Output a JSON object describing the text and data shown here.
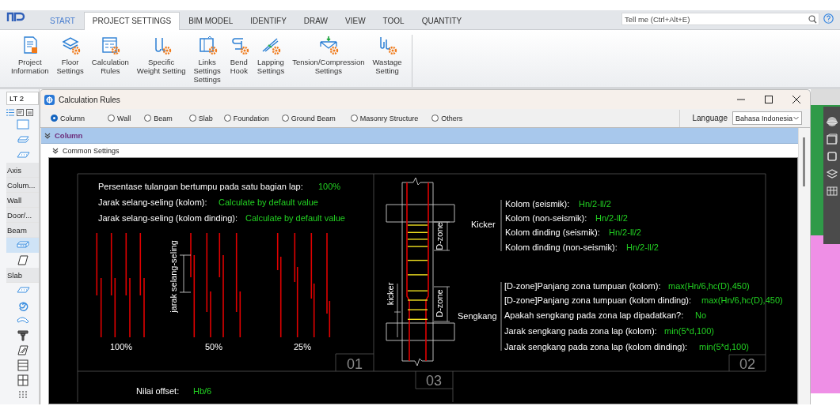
{
  "ribbon_tabs": [
    {
      "label": "START",
      "kind": "file",
      "selected": false
    },
    {
      "label": "PROJECT SETTINGS",
      "kind": "tab",
      "selected": true
    },
    {
      "label": "BIM MODEL",
      "kind": "tab",
      "selected": false
    },
    {
      "label": "IDENTIFY",
      "kind": "tab",
      "selected": false
    },
    {
      "label": "DRAW",
      "kind": "tab",
      "selected": false
    },
    {
      "label": "VIEW",
      "kind": "tab",
      "selected": false
    },
    {
      "label": "TOOL",
      "kind": "tab",
      "selected": false
    },
    {
      "label": "QUANTITY",
      "kind": "tab",
      "selected": false
    }
  ],
  "search": {
    "placeholder": "Tell me (Ctrl+Alt+E)"
  },
  "ribbon_buttons": [
    {
      "lines": [
        "Project",
        "Information"
      ]
    },
    {
      "lines": [
        "Floor",
        "Settings"
      ]
    },
    {
      "lines": [
        "Calculation",
        "Rules"
      ]
    },
    {
      "lines": [
        "Specific",
        "Weight Setting"
      ]
    },
    {
      "lines": [
        "Links",
        "Settings",
        "Settings"
      ]
    },
    {
      "lines": [
        "Bend",
        "Hook"
      ]
    },
    {
      "lines": [
        "Lapping",
        "Settings"
      ]
    },
    {
      "lines": [
        "Tension/Compression",
        "Settings"
      ]
    },
    {
      "lines": [
        "Wastage",
        "Setting"
      ]
    }
  ],
  "sidebar": {
    "floor": "LT 2",
    "items": [
      {
        "kind": "tool",
        "selected": false
      },
      {
        "kind": "tool",
        "selected": false
      },
      {
        "kind": "tool",
        "selected": false
      },
      {
        "kind": "category",
        "label": "Axis"
      },
      {
        "kind": "category",
        "label": "Colum..."
      },
      {
        "kind": "category",
        "label": "Wall"
      },
      {
        "kind": "category",
        "label": "Door/..."
      },
      {
        "kind": "category",
        "label": "Beam"
      },
      {
        "kind": "tool",
        "selected": true
      },
      {
        "kind": "tool",
        "selected": false
      },
      {
        "kind": "category",
        "label": "Slab"
      },
      {
        "kind": "tool",
        "selected": false
      },
      {
        "kind": "tool",
        "selected": false
      },
      {
        "kind": "tool",
        "selected": false
      },
      {
        "kind": "tool",
        "selected": false
      },
      {
        "kind": "tool",
        "selected": false
      },
      {
        "kind": "tool",
        "selected": false
      },
      {
        "kind": "tool",
        "selected": false
      },
      {
        "kind": "tool",
        "selected": false
      }
    ]
  },
  "dialog": {
    "title": "Calculation Rules",
    "categories": [
      {
        "label": "Column",
        "selected": true
      },
      {
        "label": "Wall",
        "selected": false
      },
      {
        "label": "Beam",
        "selected": false
      },
      {
        "label": "Slab",
        "selected": false
      },
      {
        "label": "Foundation",
        "selected": false
      },
      {
        "label": "Ground Beam",
        "selected": false
      },
      {
        "label": "Masonry Structure",
        "selected": false
      },
      {
        "label": "Others",
        "selected": false
      }
    ],
    "language": {
      "label": "Language",
      "value": "Bahasa Indonesia"
    },
    "section": {
      "title": "Column",
      "expanded": true
    },
    "subsection": {
      "title": "Common Settings",
      "expanded": true
    },
    "canvas": {
      "panels": [
        {
          "number": "01",
          "settings": [
            {
              "label": "Persentase tulangan bertumpu pada satu bagian lap:",
              "value": "100%"
            },
            {
              "label": "Jarak selang-seling (kolom):",
              "value": "Calculate by default value"
            },
            {
              "label": "Jarak selang-seling (kolom dinding):",
              "value": "Calculate by default value"
            }
          ],
          "bar_labels": [
            "100%",
            "50%",
            "25%"
          ],
          "dimension_label": "jarak selang-seling"
        },
        {
          "number": "02",
          "groups": [
            {
              "title": "Kicker",
              "settings": [
                {
                  "label": "Kolom (seismik):",
                  "value": "Hn/2-ll/2"
                },
                {
                  "label": "Kolom (non-seismik):",
                  "value": "Hn/2-ll/2"
                },
                {
                  "label": "Kolom dinding (seismik):",
                  "value": "Hn/2-ll/2"
                },
                {
                  "label": "Kolom dinding (non-seismik):",
                  "value": "Hn/2-ll/2"
                }
              ]
            },
            {
              "title": "Sengkang",
              "settings": [
                {
                  "label": "[D-zone]Panjang zona tumpuan (kolom):",
                  "value": "max(Hn/6,hc(D),450)"
                },
                {
                  "label": "[D-zone]Panjang zona tumpuan (kolom dinding):",
                  "value": "max(Hn/6,hc(D),450)"
                },
                {
                  "label": "Apakah sengkang pada zona lap dipadatkan?:",
                  "value": "No"
                },
                {
                  "label": "Jarak sengkang pada zona lap (kolom):",
                  "value": "min(5*d,100)"
                },
                {
                  "label": "Jarak sengkang pada zona lap (kolom dinding):",
                  "value": "min(5*d,100)"
                }
              ]
            }
          ],
          "drawing_labels": [
            "D-zone",
            "D-zone",
            "kicker"
          ]
        },
        {
          "number": "03",
          "settings": [
            {
              "label": "Nilai offset:",
              "value": "Hb/6"
            }
          ]
        }
      ]
    }
  }
}
